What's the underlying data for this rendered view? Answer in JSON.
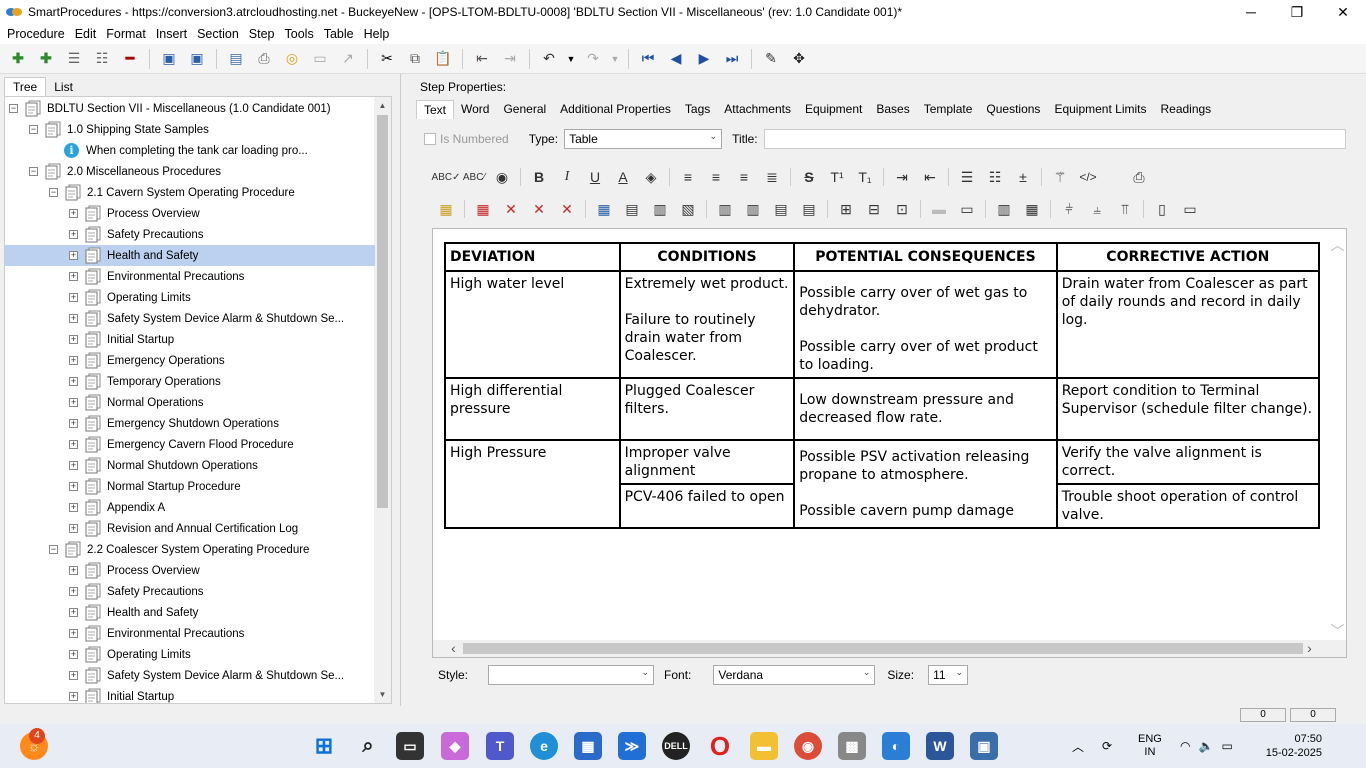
{
  "window": {
    "title": "SmartProcedures - https://conversion3.atrcloudhosting.net - BuckeyeNew - [OPS-LTOM-BDLTU-0008] 'BDLTU Section VII - Miscellaneous' (rev: 1.0 Candidate 001)*",
    "minimize": "─",
    "restore": "❐",
    "close": "✕"
  },
  "menu": [
    "Procedure",
    "Edit",
    "Format",
    "Insert",
    "Section",
    "Step",
    "Tools",
    "Table",
    "Help"
  ],
  "left_tabs": [
    "Tree",
    "List"
  ],
  "tree": [
    {
      "label": "BDLTU Section VII - Miscellaneous (1.0 Candidate 001)",
      "level": 0,
      "icon": "document-icon"
    },
    {
      "label": "1.0 Shipping State Samples",
      "level": 1,
      "icon": "document-icon"
    },
    {
      "label": "When completing the tank car loading pro...",
      "level": 2,
      "icon": "info-icon"
    },
    {
      "label": "2.0 Miscellaneous Procedures",
      "level": 1,
      "icon": "document-icon"
    },
    {
      "label": "2.1 Cavern System Operating Procedure",
      "level": 2,
      "icon": "document-icon"
    },
    {
      "label": "Process Overview",
      "level": 3,
      "icon": "document-icon"
    },
    {
      "label": "Safety Precautions",
      "level": 3,
      "icon": "document-icon"
    },
    {
      "label": "Health and Safety",
      "level": 3,
      "icon": "document-icon",
      "selected": true
    },
    {
      "label": "Environmental Precautions",
      "level": 3,
      "icon": "document-icon"
    },
    {
      "label": "Operating Limits",
      "level": 3,
      "icon": "document-icon"
    },
    {
      "label": "Safety System Device Alarm & Shutdown Se...",
      "level": 3,
      "icon": "document-icon"
    },
    {
      "label": "Initial Startup",
      "level": 3,
      "icon": "document-icon"
    },
    {
      "label": "Emergency Operations",
      "level": 3,
      "icon": "document-icon"
    },
    {
      "label": "Temporary Operations",
      "level": 3,
      "icon": "document-icon"
    },
    {
      "label": "Normal Operations",
      "level": 3,
      "icon": "document-icon"
    },
    {
      "label": "Emergency Shutdown Operations",
      "level": 3,
      "icon": "document-icon"
    },
    {
      "label": "Emergency Cavern Flood Procedure",
      "level": 3,
      "icon": "document-icon"
    },
    {
      "label": "Normal Shutdown Operations",
      "level": 3,
      "icon": "document-icon"
    },
    {
      "label": "Normal Startup Procedure",
      "level": 3,
      "icon": "document-icon"
    },
    {
      "label": "Appendix A",
      "level": 3,
      "icon": "document-icon"
    },
    {
      "label": "Revision and Annual Certification Log",
      "level": 3,
      "icon": "document-icon"
    },
    {
      "label": "2.2 Coalescer System Operating Procedure",
      "level": 2,
      "icon": "document-icon"
    },
    {
      "label": "Process Overview",
      "level": 3,
      "icon": "document-icon"
    },
    {
      "label": "Safety Precautions",
      "level": 3,
      "icon": "document-icon"
    },
    {
      "label": "Health and Safety",
      "level": 3,
      "icon": "document-icon"
    },
    {
      "label": "Environmental Precautions",
      "level": 3,
      "icon": "document-icon"
    },
    {
      "label": "Operating Limits",
      "level": 3,
      "icon": "document-icon"
    },
    {
      "label": "Safety System Device Alarm & Shutdown Se...",
      "level": 3,
      "icon": "document-icon"
    },
    {
      "label": "Initial Startup",
      "level": 3,
      "icon": "document-icon"
    }
  ],
  "step_properties": {
    "label": "Step Properties:",
    "tabs": [
      "Text",
      "Word",
      "General",
      "Additional Properties",
      "Tags",
      "Attachments",
      "Equipment",
      "Bases",
      "Template",
      "Questions",
      "Equipment Limits",
      "Readings"
    ],
    "is_numbered_label": "Is Numbered",
    "type_label": "Type:",
    "type_value": "Table",
    "title_label": "Title:",
    "title_value": ""
  },
  "table": {
    "headers": [
      "DEVIATION",
      "CONDITIONS",
      "POTENTIAL CONSEQUENCES",
      "CORRECTIVE ACTION"
    ],
    "row1": {
      "deviation": "High water level",
      "conditions": [
        "Extremely wet product.",
        "Failure to routinely drain water from Coalescer."
      ],
      "consequences": [
        "Possible carry over of wet gas to dehydrator.",
        "Possible carry over of wet product to loading."
      ],
      "action": "Drain water from Coalescer as part of daily rounds and record in daily log."
    },
    "row2": {
      "deviation": "High differential pressure",
      "conditions": "Plugged Coalescer filters.",
      "consequences": "Low downstream pressure and decreased flow rate.",
      "action": "Report condition to Terminal Supervisor (schedule filter change)."
    },
    "row3": {
      "deviation": "High Pressure",
      "conditions_a": "Improper valve alignment",
      "conditions_b": "PCV-406 failed to open",
      "consequences": [
        "Possible PSV activation releasing propane to atmosphere.",
        "Possible cavern pump damage"
      ],
      "action_a": "Verify the valve alignment is correct.",
      "action_b": "Trouble shoot operation of control valve."
    }
  },
  "bottom": {
    "style_label": "Style:",
    "style_value": "",
    "font_label": "Font:",
    "font_value": "Verdana",
    "size_label": "Size:",
    "size_value": "11"
  },
  "status": {
    "box1": "0",
    "box2": "0"
  },
  "taskbar": {
    "notification_count": "4",
    "language": "ENG",
    "region": "IN",
    "time": "07:50",
    "date": "15-02-2025"
  }
}
